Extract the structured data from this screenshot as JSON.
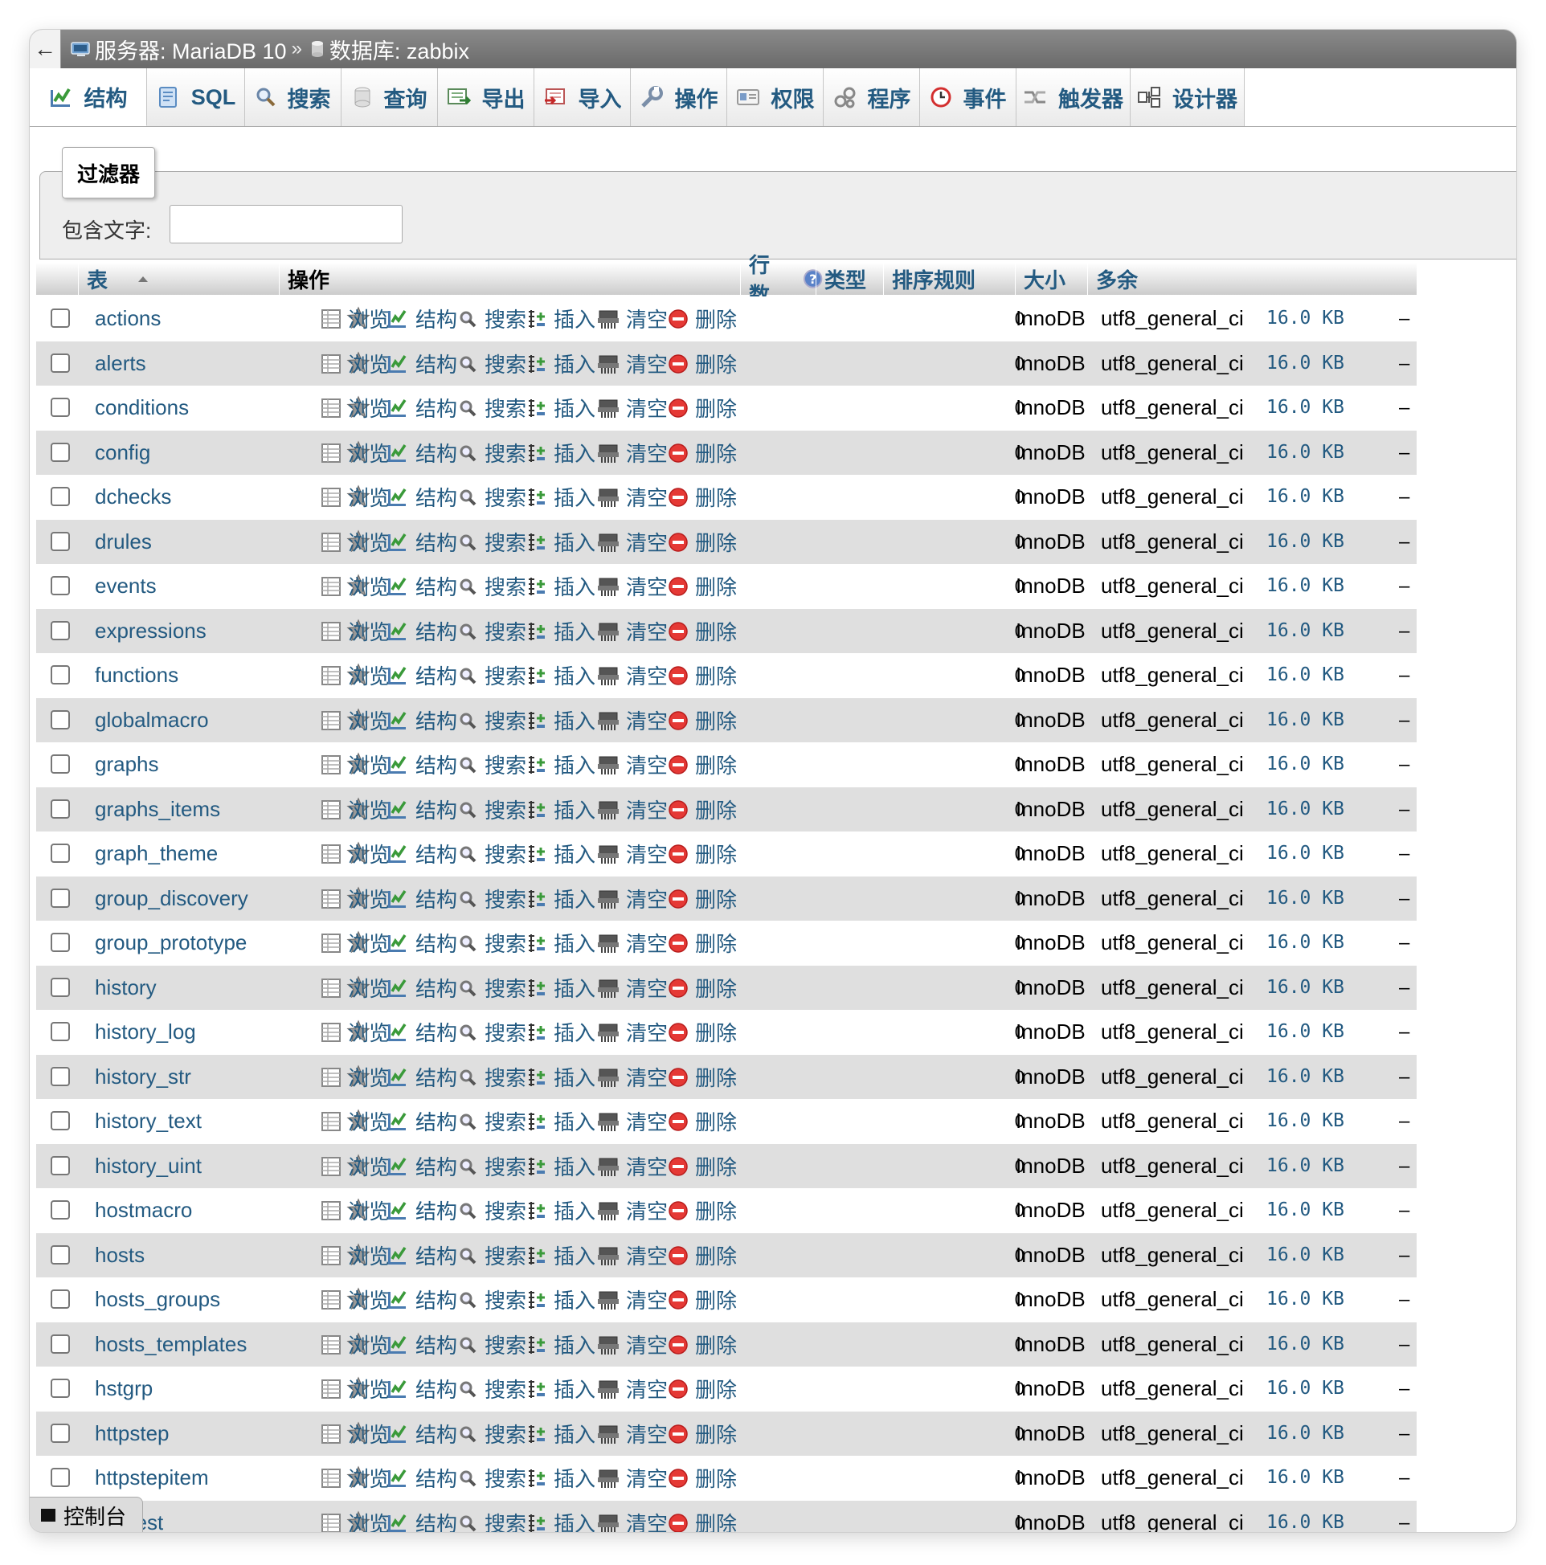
{
  "breadcrumb": {
    "server": "服务器: MariaDB 10",
    "database": "数据库: zabbix"
  },
  "tabs": [
    {
      "label": "结构",
      "icon": "structure-icon",
      "width": 146
    },
    {
      "label": "SQL",
      "icon": "sql-icon",
      "width": 122
    },
    {
      "label": "搜索",
      "icon": "search-icon",
      "width": 120
    },
    {
      "label": "查询",
      "icon": "query-icon",
      "width": 120
    },
    {
      "label": "导出",
      "icon": "export-icon",
      "width": 120
    },
    {
      "label": "导入",
      "icon": "import-icon",
      "width": 120
    },
    {
      "label": "操作",
      "icon": "operations-icon",
      "width": 120
    },
    {
      "label": "权限",
      "icon": "privileges-icon",
      "width": 120
    },
    {
      "label": "程序",
      "icon": "routines-icon",
      "width": 120
    },
    {
      "label": "事件",
      "icon": "events-icon",
      "width": 120
    },
    {
      "label": "触发器",
      "icon": "triggers-icon",
      "width": 142
    },
    {
      "label": "设计器",
      "icon": "designer-icon",
      "width": 142
    }
  ],
  "filter": {
    "legend": "过滤器",
    "label": "包含文字:",
    "value": ""
  },
  "table_header": {
    "table": "表",
    "action": "操作",
    "rows": "行数",
    "type": "类型",
    "collation": "排序规则",
    "size": "大小",
    "overhead": "多余"
  },
  "actions": {
    "browse": "浏览",
    "structure": "结构",
    "search": "搜索",
    "insert": "插入",
    "empty": "清空",
    "drop": "删除"
  },
  "rows": [
    {
      "name": "actions",
      "rows": "0",
      "engine": "InnoDB",
      "collation": "utf8_general_ci",
      "size": "16.0 KB",
      "overhead": "–"
    },
    {
      "name": "alerts",
      "rows": "0",
      "engine": "InnoDB",
      "collation": "utf8_general_ci",
      "size": "16.0 KB",
      "overhead": "–"
    },
    {
      "name": "conditions",
      "rows": "0",
      "engine": "InnoDB",
      "collation": "utf8_general_ci",
      "size": "16.0 KB",
      "overhead": "–"
    },
    {
      "name": "config",
      "rows": "0",
      "engine": "InnoDB",
      "collation": "utf8_general_ci",
      "size": "16.0 KB",
      "overhead": "–"
    },
    {
      "name": "dchecks",
      "rows": "0",
      "engine": "InnoDB",
      "collation": "utf8_general_ci",
      "size": "16.0 KB",
      "overhead": "–"
    },
    {
      "name": "drules",
      "rows": "0",
      "engine": "InnoDB",
      "collation": "utf8_general_ci",
      "size": "16.0 KB",
      "overhead": "–"
    },
    {
      "name": "events",
      "rows": "0",
      "engine": "InnoDB",
      "collation": "utf8_general_ci",
      "size": "16.0 KB",
      "overhead": "–"
    },
    {
      "name": "expressions",
      "rows": "0",
      "engine": "InnoDB",
      "collation": "utf8_general_ci",
      "size": "16.0 KB",
      "overhead": "–"
    },
    {
      "name": "functions",
      "rows": "0",
      "engine": "InnoDB",
      "collation": "utf8_general_ci",
      "size": "16.0 KB",
      "overhead": "–"
    },
    {
      "name": "globalmacro",
      "rows": "0",
      "engine": "InnoDB",
      "collation": "utf8_general_ci",
      "size": "16.0 KB",
      "overhead": "–"
    },
    {
      "name": "graphs",
      "rows": "0",
      "engine": "InnoDB",
      "collation": "utf8_general_ci",
      "size": "16.0 KB",
      "overhead": "–"
    },
    {
      "name": "graphs_items",
      "rows": "0",
      "engine": "InnoDB",
      "collation": "utf8_general_ci",
      "size": "16.0 KB",
      "overhead": "–"
    },
    {
      "name": "graph_theme",
      "rows": "0",
      "engine": "InnoDB",
      "collation": "utf8_general_ci",
      "size": "16.0 KB",
      "overhead": "–"
    },
    {
      "name": "group_discovery",
      "rows": "0",
      "engine": "InnoDB",
      "collation": "utf8_general_ci",
      "size": "16.0 KB",
      "overhead": "–"
    },
    {
      "name": "group_prototype",
      "rows": "0",
      "engine": "InnoDB",
      "collation": "utf8_general_ci",
      "size": "16.0 KB",
      "overhead": "–"
    },
    {
      "name": "history",
      "rows": "0",
      "engine": "InnoDB",
      "collation": "utf8_general_ci",
      "size": "16.0 KB",
      "overhead": "–"
    },
    {
      "name": "history_log",
      "rows": "0",
      "engine": "InnoDB",
      "collation": "utf8_general_ci",
      "size": "16.0 KB",
      "overhead": "–"
    },
    {
      "name": "history_str",
      "rows": "0",
      "engine": "InnoDB",
      "collation": "utf8_general_ci",
      "size": "16.0 KB",
      "overhead": "–"
    },
    {
      "name": "history_text",
      "rows": "0",
      "engine": "InnoDB",
      "collation": "utf8_general_ci",
      "size": "16.0 KB",
      "overhead": "–"
    },
    {
      "name": "history_uint",
      "rows": "0",
      "engine": "InnoDB",
      "collation": "utf8_general_ci",
      "size": "16.0 KB",
      "overhead": "–"
    },
    {
      "name": "hostmacro",
      "rows": "0",
      "engine": "InnoDB",
      "collation": "utf8_general_ci",
      "size": "16.0 KB",
      "overhead": "–"
    },
    {
      "name": "hosts",
      "rows": "0",
      "engine": "InnoDB",
      "collation": "utf8_general_ci",
      "size": "16.0 KB",
      "overhead": "–"
    },
    {
      "name": "hosts_groups",
      "rows": "0",
      "engine": "InnoDB",
      "collation": "utf8_general_ci",
      "size": "16.0 KB",
      "overhead": "–"
    },
    {
      "name": "hosts_templates",
      "rows": "0",
      "engine": "InnoDB",
      "collation": "utf8_general_ci",
      "size": "16.0 KB",
      "overhead": "–"
    },
    {
      "name": "hstgrp",
      "rows": "0",
      "engine": "InnoDB",
      "collation": "utf8_general_ci",
      "size": "16.0 KB",
      "overhead": "–"
    },
    {
      "name": "httpstep",
      "rows": "0",
      "engine": "InnoDB",
      "collation": "utf8_general_ci",
      "size": "16.0 KB",
      "overhead": "–"
    },
    {
      "name": "httpstepitem",
      "rows": "0",
      "engine": "InnoDB",
      "collation": "utf8_general_ci",
      "size": "16.0 KB",
      "overhead": "–"
    },
    {
      "name": "httptest",
      "rows": "0",
      "engine": "InnoDB",
      "collation": "utf8_general_ci",
      "size": "16.0 KB",
      "overhead": "–"
    }
  ],
  "console": {
    "label": "控制台"
  },
  "colors": {
    "link": "#235a81",
    "row_alt": "#dfdfdf",
    "drop_red": "#e53935",
    "star": "#8a8a8a"
  }
}
